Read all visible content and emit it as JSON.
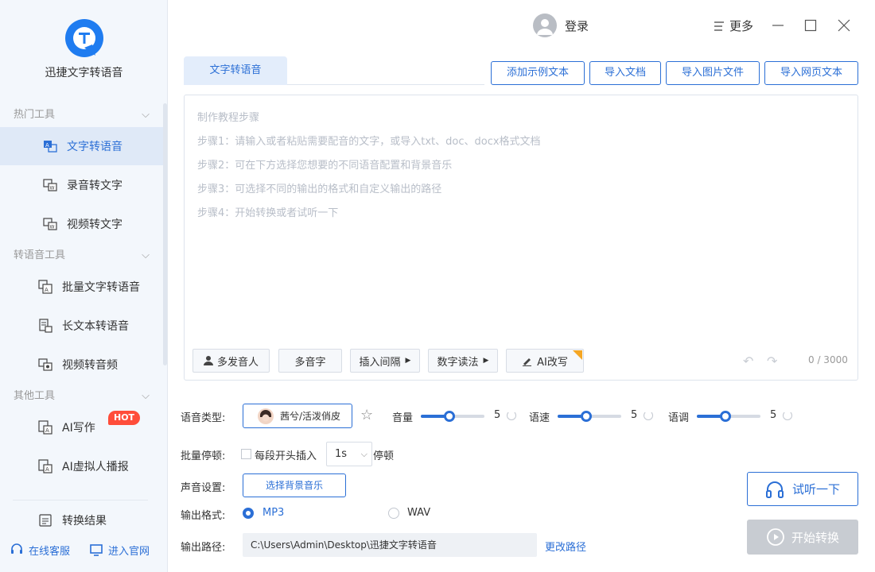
{
  "app": {
    "title": "迅捷文字转语音"
  },
  "sidebar": {
    "sections": [
      {
        "label": "热门工具",
        "items": [
          {
            "label": "文字转语音",
            "active": true
          },
          {
            "label": "录音转文字"
          },
          {
            "label": "视频转文字"
          }
        ]
      },
      {
        "label": "转语音工具",
        "items": [
          {
            "label": "批量文字转语音"
          },
          {
            "label": "长文本转语音"
          },
          {
            "label": "视频转音频"
          }
        ]
      },
      {
        "label": "其他工具",
        "items": [
          {
            "label": "AI写作",
            "badge": "HOT"
          },
          {
            "label": "AI虚拟人播报"
          }
        ]
      }
    ],
    "result_label": "转换结果",
    "footer": {
      "service": "在线客服",
      "website": "进入官网"
    }
  },
  "topbar": {
    "login": "登录",
    "more": "更多"
  },
  "tab": {
    "label": "文字转语音"
  },
  "toolbar": {
    "example": "添加示例文本",
    "import_doc": "导入文档",
    "import_image": "导入图片文件",
    "import_web": "导入网页文本"
  },
  "editor": {
    "placeholder": [
      "制作教程步骤",
      "步骤1：请输入或者粘贴需要配音的文字，或导入txt、doc、docx格式文档",
      "步骤2：可在下方选择您想要的不同语音配置和背景音乐",
      "步骤3：可选择不同的输出的格式和自定义输出的路径",
      "步骤4：开始转换或者试听一下"
    ],
    "buttons": {
      "multi_voice": "多发音人",
      "polyphone": "多音字",
      "insert_pause": "插入间隔",
      "number_read": "数字读法",
      "ai_rewrite": "AI改写"
    },
    "counter": "0 / 3000"
  },
  "settings": {
    "voice_type_label": "语音类型:",
    "voice_name": "茜兮/活泼俏皮",
    "volume": {
      "label": "音量",
      "value": 5,
      "fraction": 0.45
    },
    "speed": {
      "label": "语速",
      "value": 5,
      "fraction": 0.45
    },
    "pitch": {
      "label": "语调",
      "value": 5,
      "fraction": 0.45
    },
    "batch_pause_label": "批量停顿:",
    "batch_pause_check": "每段开头插入",
    "batch_pause_value": "1s",
    "batch_pause_suffix": "停顿",
    "sound_label": "声音设置:",
    "bgm_button": "选择背景音乐",
    "format_label": "输出格式:",
    "format_mp3": "MP3",
    "format_wav": "WAV",
    "path_label": "输出路径:",
    "path_value": "C:\\Users\\Admin\\Desktop\\迅捷文字转语音",
    "change_path": "更改路径"
  },
  "actions": {
    "listen": "试听一下",
    "start": "开始转换"
  },
  "colors": {
    "accent": "#2b6fd6",
    "hot": "#ff4d3a",
    "sidebar_bg": "#f3f7fc"
  }
}
